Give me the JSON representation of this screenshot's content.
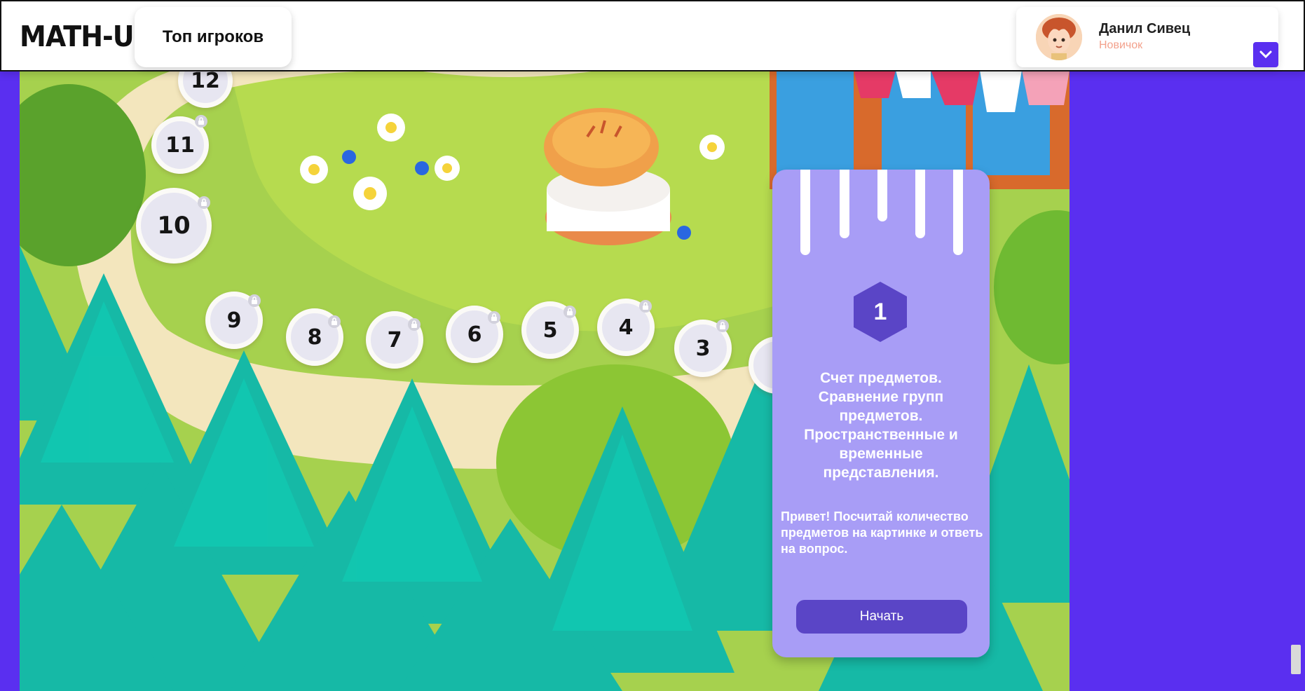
{
  "header": {
    "logo": "MATH-UP",
    "top_players_label": "Топ игроков",
    "user": {
      "name": "Данил Сивец",
      "rank": "Новичок"
    }
  },
  "map": {
    "levels": [
      {
        "number": "12",
        "locked": true
      },
      {
        "number": "11",
        "locked": true
      },
      {
        "number": "10",
        "locked": true
      },
      {
        "number": "9",
        "locked": true
      },
      {
        "number": "8",
        "locked": true
      },
      {
        "number": "7",
        "locked": true
      },
      {
        "number": "6",
        "locked": true
      },
      {
        "number": "5",
        "locked": true
      },
      {
        "number": "4",
        "locked": true
      },
      {
        "number": "3",
        "locked": true
      }
    ]
  },
  "level_card": {
    "number": "1",
    "title": "Счет предметов. Сравнение групп предметов. Пространственные и временные представления.",
    "description": "Привет! Посчитай количество предметов на картинке и ответь на вопрос.",
    "start_label": "Начать"
  },
  "colors": {
    "accent": "#5a2ff0",
    "card": "#a89df6",
    "button": "#5a45c6",
    "rank": "#f3a18c"
  }
}
